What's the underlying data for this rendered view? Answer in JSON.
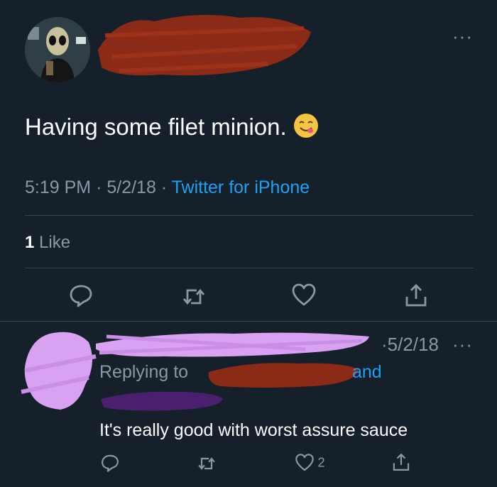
{
  "tweet": {
    "text": "Having some filet minion.",
    "emoji": "yum-face-emoji",
    "time": "5:19 PM",
    "date": "5/2/18",
    "separator": "·",
    "source": "Twitter for iPhone",
    "like_count": "1",
    "like_label": "Like"
  },
  "reply": {
    "date": "·5/2/18",
    "replying_to_label": "Replying to",
    "and_label": "and",
    "text": "It's really good with worst assure sauce",
    "like_count": "2"
  },
  "more_label": "···",
  "colors": {
    "background": "#15202b",
    "secondary_text": "#8899a6",
    "link": "#1da1f2",
    "divider": "#38444d",
    "red_scribble": "#8b2a17",
    "pink_scribble": "#d9a1f2",
    "purple_scribble": "#4a1f6e"
  },
  "icons": [
    "reply-icon",
    "retweet-icon",
    "like-icon",
    "share-icon"
  ]
}
